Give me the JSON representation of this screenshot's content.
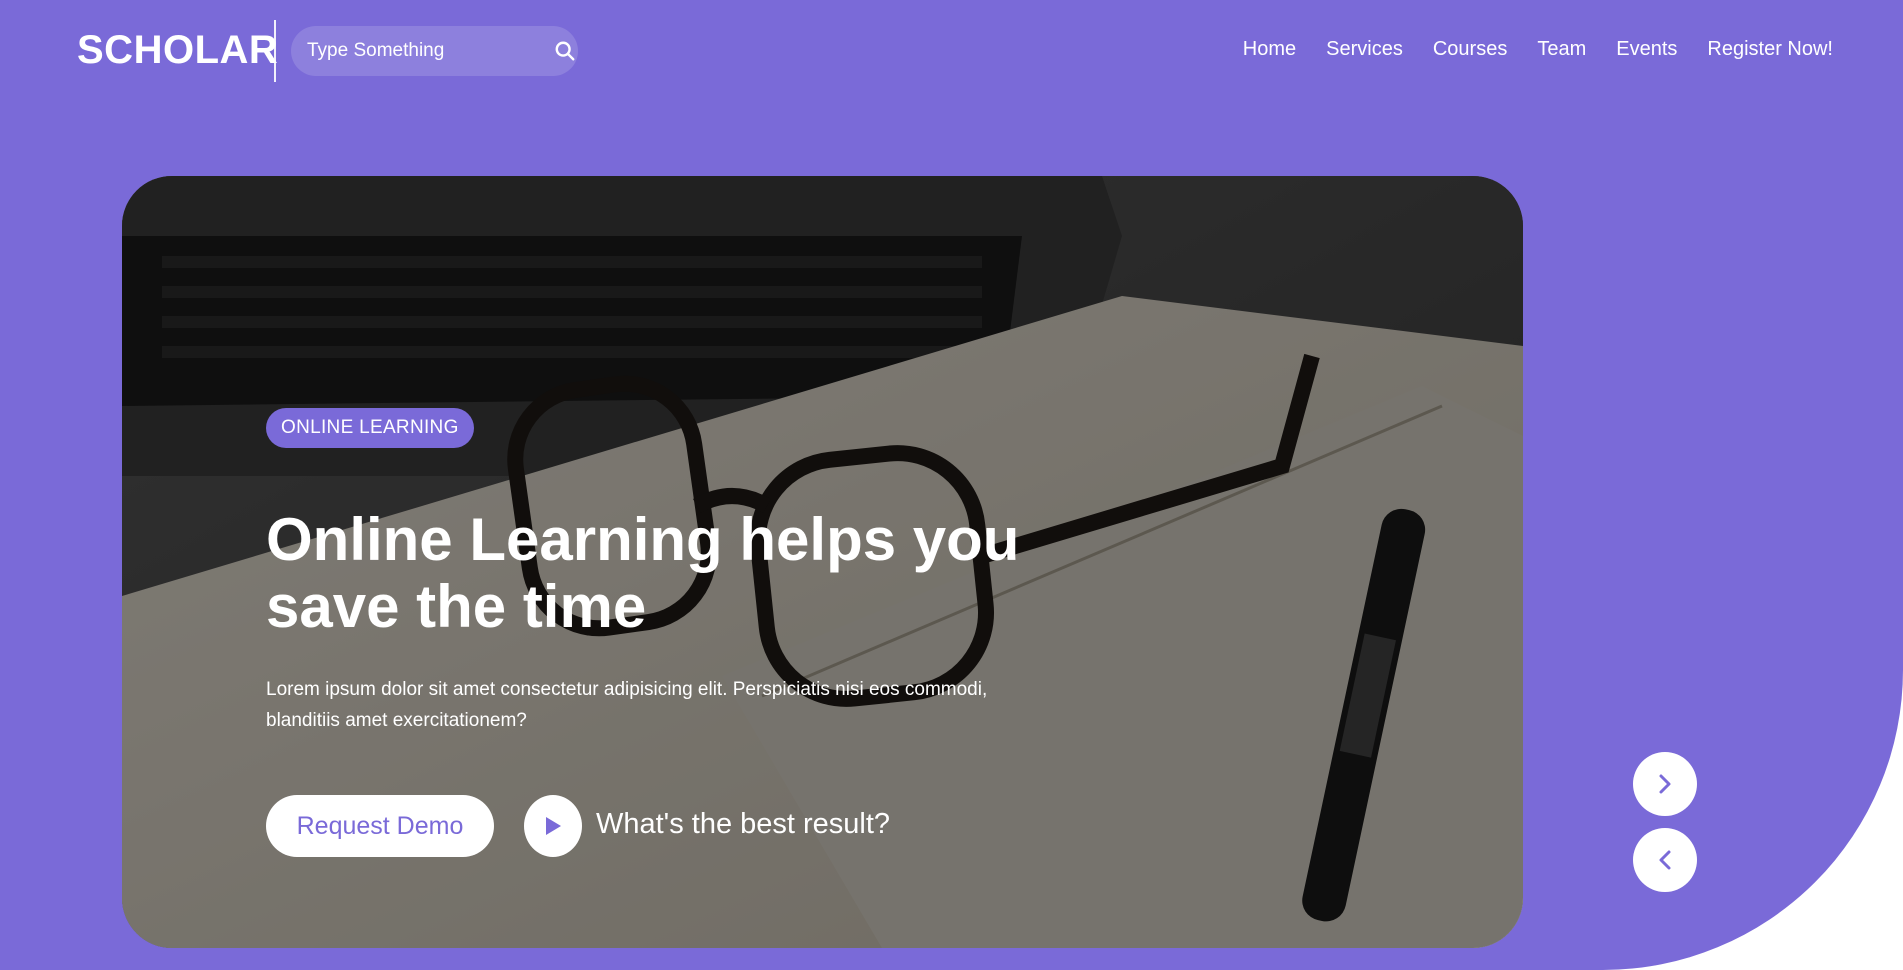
{
  "brand": {
    "logo": "SCHOLAR"
  },
  "search": {
    "placeholder": "Type Something"
  },
  "nav": {
    "items": [
      "Home",
      "Services",
      "Courses",
      "Team",
      "Events",
      "Register Now!"
    ]
  },
  "hero": {
    "badge": "ONLINE LEARNING",
    "title": "Online Learning helps you save the time",
    "description": "Lorem ipsum dolor sit amet consectetur adipisicing elit. Perspiciatis nisi eos commodi, blanditiis amet exercitationem?",
    "primary_button": "Request Demo",
    "secondary_link": "What's the best result?"
  },
  "carousel": {
    "next_icon": "chevron-right-icon",
    "prev_icon": "chevron-left-icon"
  },
  "colors": {
    "accent": "#7a6ad8",
    "white": "#ffffff"
  }
}
